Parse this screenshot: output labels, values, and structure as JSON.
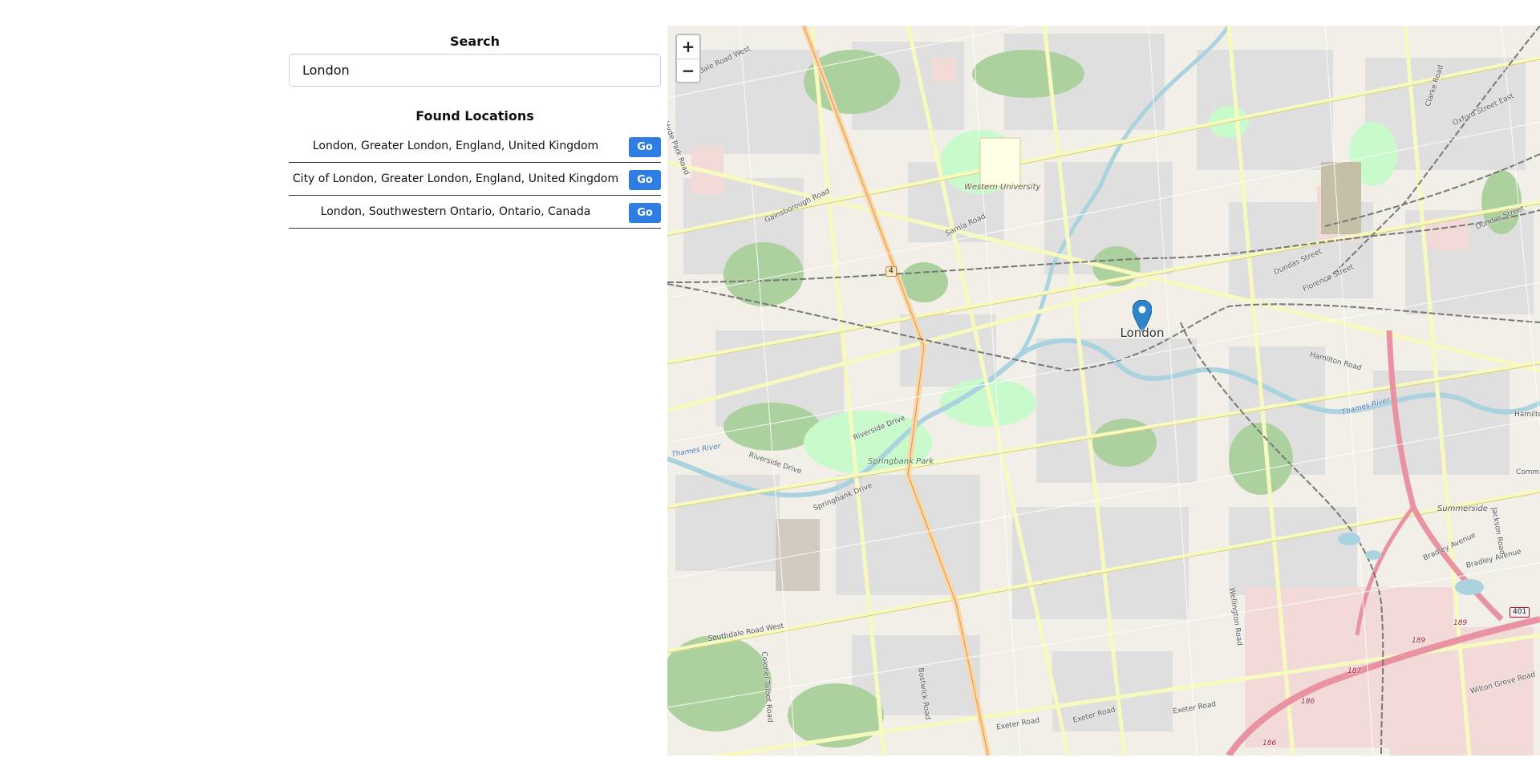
{
  "search": {
    "heading": "Search",
    "value": "London",
    "placeholder": ""
  },
  "results": {
    "heading": "Found Locations",
    "items": [
      {
        "label": "London, Greater London, England, United Kingdom",
        "button": "Go"
      },
      {
        "label": "City of London, Greater London, England, United Kingdom",
        "button": "Go"
      },
      {
        "label": "London, Southwestern Ontario, Ontario, Canada",
        "button": "Go"
      }
    ]
  },
  "map": {
    "zoom_in": "+",
    "zoom_out": "−",
    "marker_label": "London",
    "labels": {
      "oxford_street_east": "Oxford Street East",
      "dundas_street": "Dundas Street",
      "dundas_street_2": "Dundas Street",
      "florence_street": "Florence Street",
      "hamilton_road": "Hamilton Road",
      "sarnia_road": "Sarnia Road",
      "gainsborough_road": "Gainsborough Road",
      "riverside_drive": "Riverside Drive",
      "riverside_drive_2": "Riverside Drive",
      "springbank_drive": "Springbank Drive",
      "southdale_road_west": "Southdale Road West",
      "colonel_talbot_road": "Colonel Talbot Road",
      "bostwick_road": "Bostwick Road",
      "exeter_road": "Exeter Road",
      "exeter_road_2": "Exeter Road",
      "exeter_road_3": "Exeter Road",
      "wellington_road": "Wellington Road",
      "bradley_avenue": "Bradley Avenue",
      "bradley_avenue_2": "Bradley Avenue",
      "wilton_grove_road": "Wilton Grove Road",
      "clarke_road": "Clarke Road",
      "jackson_road": "Jackson Road",
      "hyde_park_road": "Hyde Park Road",
      "fanshawe_road_west": "Oakdale Road West",
      "western_university": "Western University",
      "springbank_park": "Springbank Park",
      "thames_river": "Thames River",
      "summerside": "Summerside",
      "hamilton_edge": "Hamilton",
      "commissioners_edge": "Commi"
    },
    "shields": {
      "hwy4": "4",
      "hwy401": "401",
      "exit189": "189",
      "exit189b": "189",
      "exit187": "187",
      "exit186": "186",
      "exit186b": "186"
    },
    "colors": {
      "land": "#f2efe9",
      "residential": "#e0dfdf",
      "park": "#c8facc",
      "wood": "#add19e",
      "water": "#aad3df",
      "major_road": "#f7fabf",
      "trunk_road": "#fcd6a4",
      "motorway": "#e892a2",
      "rail": "#777777",
      "marker": "#2f84cc",
      "go_button": "#2f7de2"
    }
  }
}
